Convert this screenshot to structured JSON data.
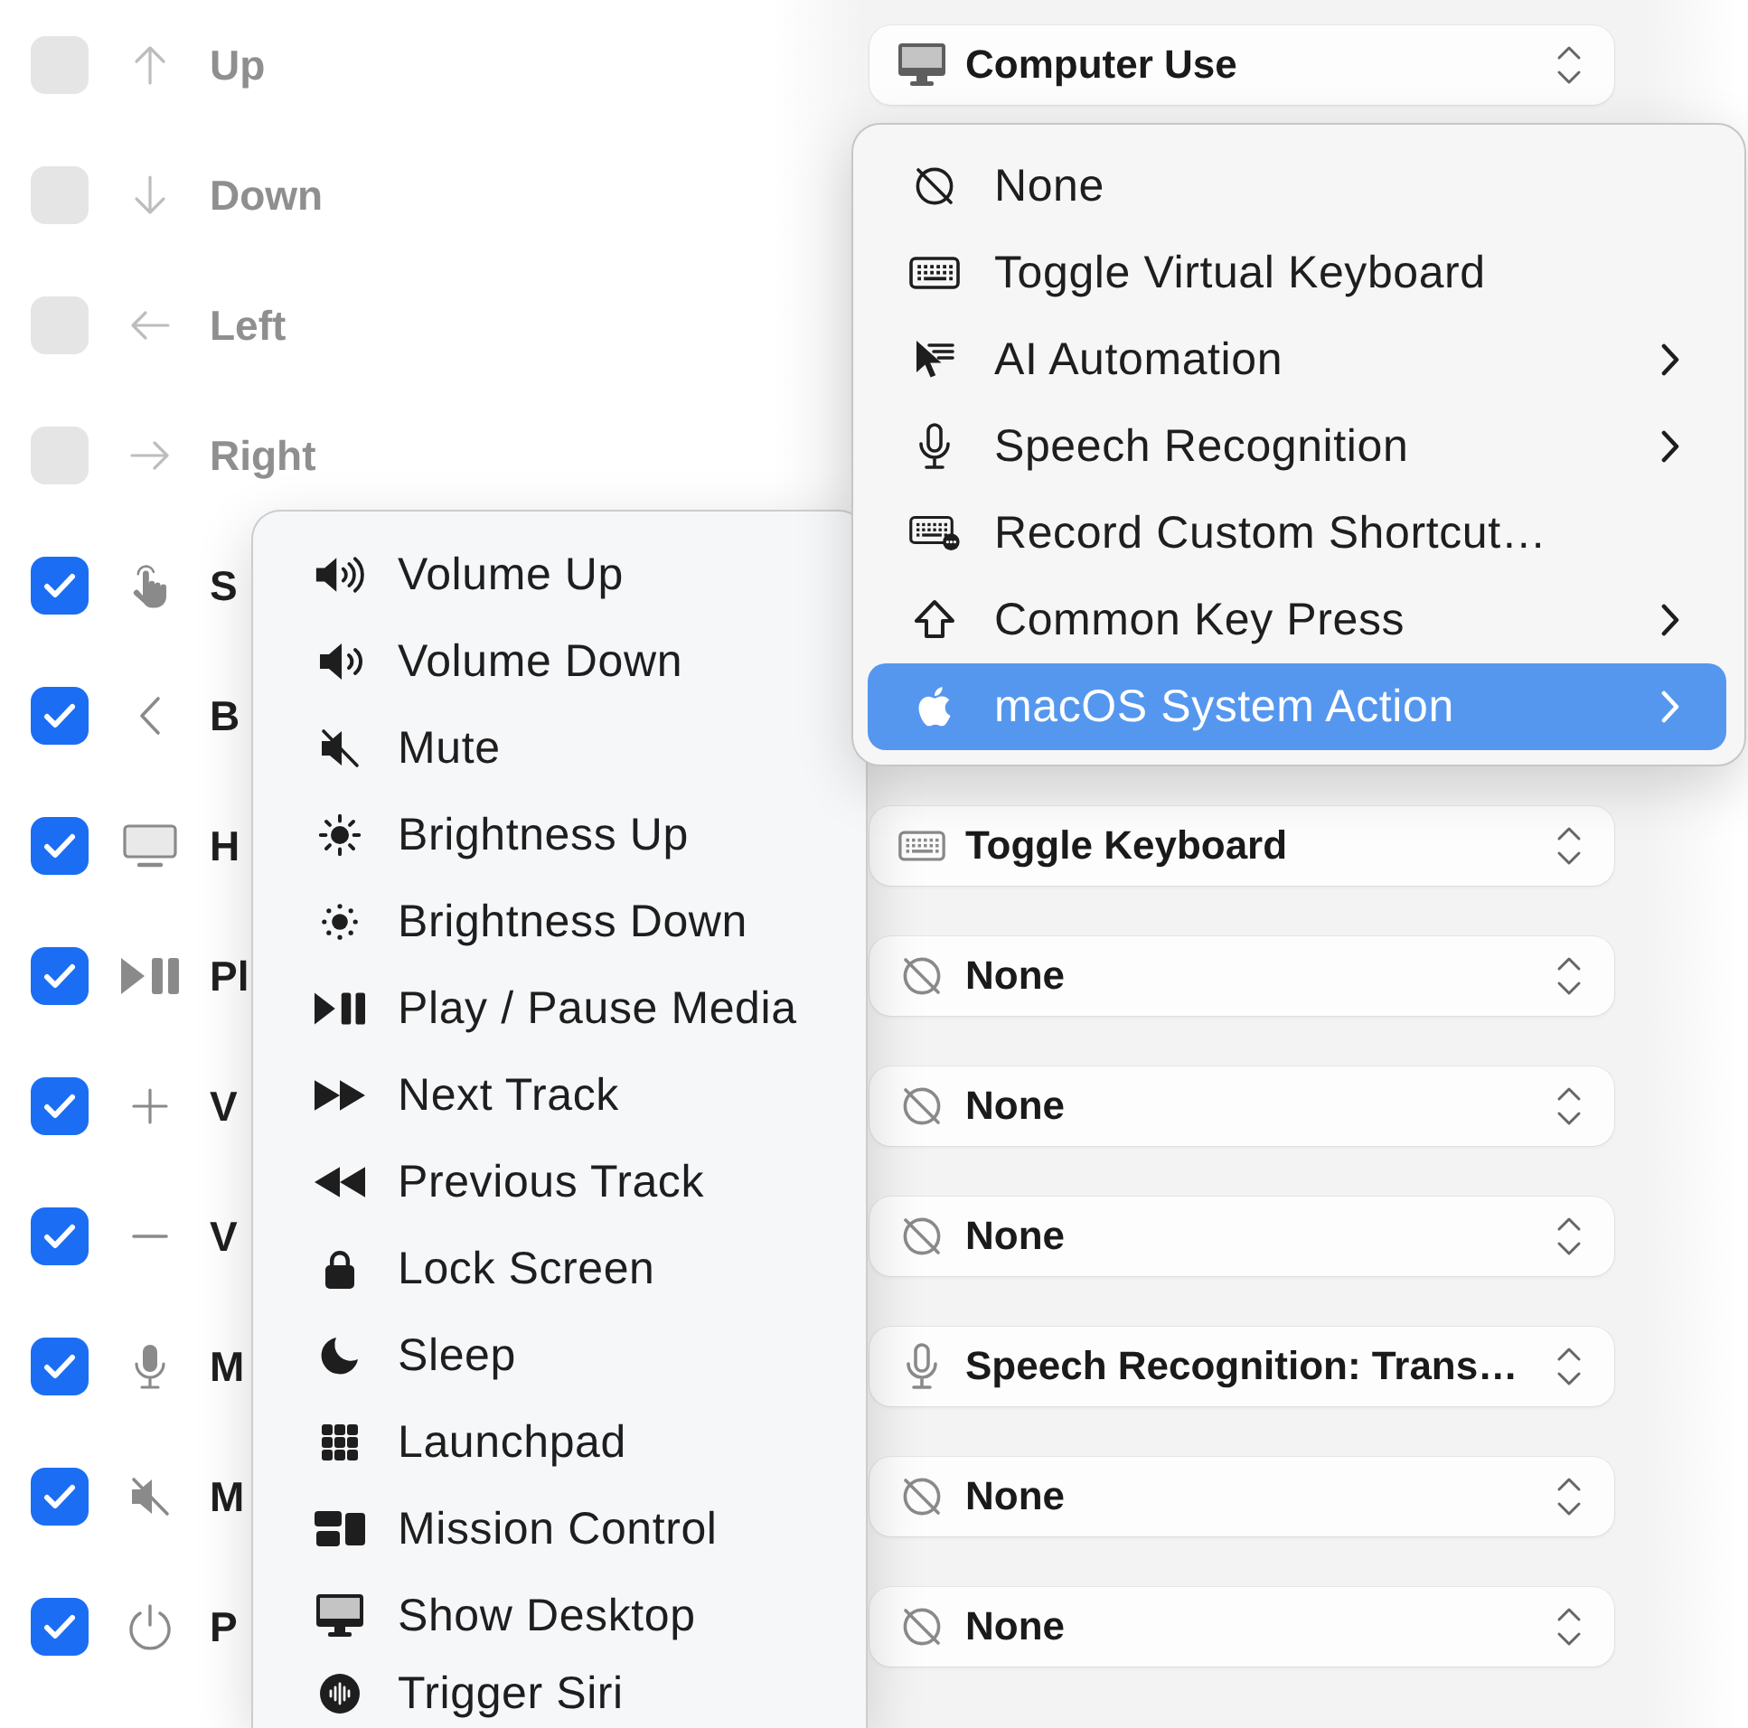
{
  "rows": [
    {
      "label": "Up",
      "checked": false,
      "dropdown": {
        "label": "Computer Use"
      }
    },
    {
      "label": "Down",
      "checked": false
    },
    {
      "label": "Left",
      "checked": false
    },
    {
      "label": "Right",
      "checked": false
    },
    {
      "label": "S",
      "checked": true
    },
    {
      "label": "B",
      "checked": true
    },
    {
      "label": "H",
      "checked": true,
      "dropdown": {
        "label": "Toggle Keyboard"
      }
    },
    {
      "label": "Pl",
      "checked": true,
      "dropdown": {
        "label": "None"
      }
    },
    {
      "label": "V",
      "checked": true,
      "dropdown": {
        "label": "None"
      }
    },
    {
      "label": "V",
      "checked": true,
      "dropdown": {
        "label": "None"
      }
    },
    {
      "label": "M",
      "checked": true,
      "dropdown": {
        "label": "Speech Recognition: Trans…"
      }
    },
    {
      "label": "M",
      "checked": true,
      "dropdown": {
        "label": "None"
      }
    },
    {
      "label": "P",
      "checked": true,
      "dropdown": {
        "label": "None"
      }
    }
  ],
  "action_menu": {
    "items": [
      {
        "label": "None",
        "has_submenu": false,
        "selected": false
      },
      {
        "label": "Toggle Virtual Keyboard",
        "has_submenu": false,
        "selected": false
      },
      {
        "label": "AI Automation",
        "has_submenu": true,
        "selected": false
      },
      {
        "label": "Speech Recognition",
        "has_submenu": true,
        "selected": false
      },
      {
        "label": "Record Custom Shortcut…",
        "has_submenu": false,
        "selected": false
      },
      {
        "label": "Common Key Press",
        "has_submenu": true,
        "selected": false
      },
      {
        "label": "macOS System Action",
        "has_submenu": true,
        "selected": true
      }
    ]
  },
  "system_action_submenu": {
    "items": [
      {
        "label": "Volume Up",
        "selected": false
      },
      {
        "label": "Volume Down",
        "selected": false
      },
      {
        "label": "Mute",
        "selected": false
      },
      {
        "label": "Brightness Up",
        "selected": false
      },
      {
        "label": "Brightness Down",
        "selected": false
      },
      {
        "label": "Play / Pause Media",
        "selected": false
      },
      {
        "label": "Next Track",
        "selected": false
      },
      {
        "label": "Previous Track",
        "selected": false
      },
      {
        "label": "Lock Screen",
        "selected": false
      },
      {
        "label": "Sleep",
        "selected": false
      },
      {
        "label": "Launchpad",
        "selected": false
      },
      {
        "label": "Mission Control",
        "selected": false
      },
      {
        "label": "Show Desktop",
        "selected": false
      },
      {
        "label": "Trigger Siri",
        "selected": false
      }
    ]
  }
}
